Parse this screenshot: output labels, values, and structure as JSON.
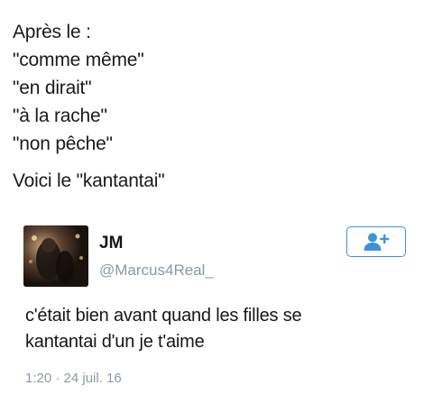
{
  "caption": {
    "lines": [
      "Après le :",
      "\"comme même\"",
      "\"en dirait\"",
      "\"à la rache\"",
      "\"non pêche\""
    ],
    "closing": "Voici le \"kantantai\""
  },
  "tweet": {
    "display_name": "JM",
    "handle": "@Marcus4Real_",
    "text_lines": [
      "c'était bien avant quand les filles se",
      "kantantai d'un je t'aime"
    ],
    "timestamp": "1:20 · 24 juil. 16",
    "follow_icon": "add-user-icon"
  },
  "colors": {
    "accent": "#3b94d9",
    "secondary_text": "#8899a6",
    "primary_text": "#14171a"
  }
}
